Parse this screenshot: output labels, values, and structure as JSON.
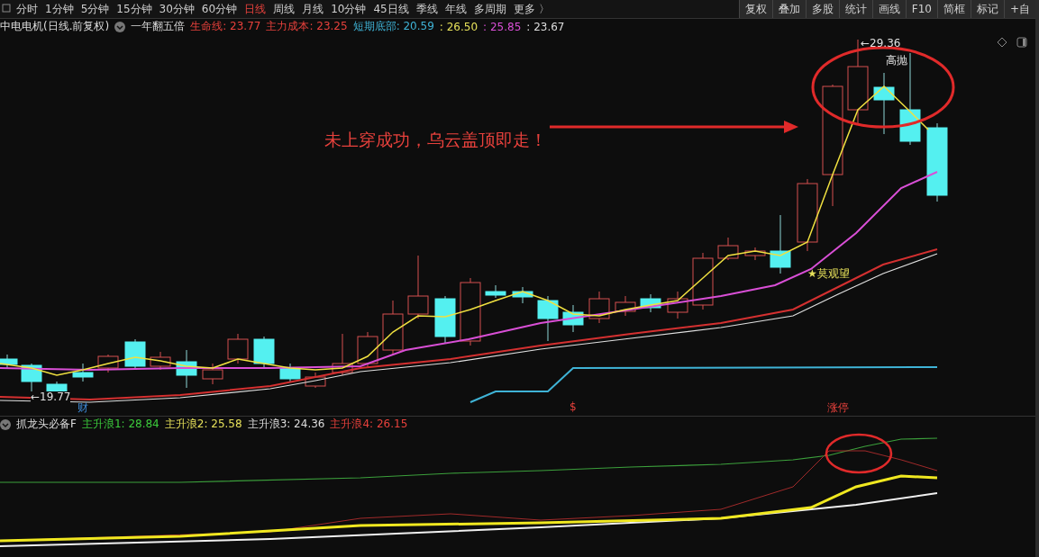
{
  "periods": [
    {
      "label": "分时",
      "selected": false
    },
    {
      "label": "1分钟",
      "selected": false
    },
    {
      "label": "5分钟",
      "selected": false
    },
    {
      "label": "15分钟",
      "selected": false
    },
    {
      "label": "30分钟",
      "selected": false
    },
    {
      "label": "60分钟",
      "selected": false
    },
    {
      "label": "日线",
      "selected": true
    },
    {
      "label": "周线",
      "selected": false
    },
    {
      "label": "月线",
      "selected": false
    },
    {
      "label": "10分钟",
      "selected": false
    },
    {
      "label": "45日线",
      "selected": false
    },
    {
      "label": "季线",
      "selected": false
    },
    {
      "label": "年线",
      "selected": false
    },
    {
      "label": "多周期",
      "selected": false
    },
    {
      "label": "更多 〉",
      "selected": false
    }
  ],
  "tools": [
    "复权",
    "叠加",
    "多股",
    "统计",
    "画线",
    "F10",
    "简框",
    "标记",
    "+自"
  ],
  "info": {
    "title": "中电电机(日线.前复权)",
    "indicator": "一年翻五倍",
    "values": [
      {
        "text": "生命线: 23.77",
        "color": "#e8413c"
      },
      {
        "text": "主力成本: 23.25",
        "color": "#e8413c"
      },
      {
        "text": "短期底部: 20.59",
        "color": "#3fb3d6"
      },
      {
        "text": ": 26.50",
        "color": "#e6e05a"
      },
      {
        "text": ": 25.85",
        "color": "#d94fd6"
      },
      {
        "text": ": 23.67",
        "color": "#dddddd"
      }
    ]
  },
  "chart": {
    "high_label": "←29.36",
    "low_label": "←19.77",
    "sell_label": "高抛",
    "watch_label": "★莫观望",
    "annotation": "未上穿成功，乌云盖顶即走！",
    "markers": [
      {
        "text": "财",
        "kind": "finance"
      },
      {
        "text": "$",
        "kind": "dollar"
      },
      {
        "text": "涨停",
        "kind": "limit"
      }
    ]
  },
  "sub": {
    "title": "抓龙头必备F",
    "values": [
      {
        "text": "主升浪1: 28.84",
        "color": "#3ccb3c"
      },
      {
        "text": "主升浪2: 25.58",
        "color": "#e6e05a"
      },
      {
        "text": "主升浪3: 24.36",
        "color": "#dddddd"
      },
      {
        "text": "主升浪4: 26.15",
        "color": "#e8413c"
      }
    ]
  }
}
